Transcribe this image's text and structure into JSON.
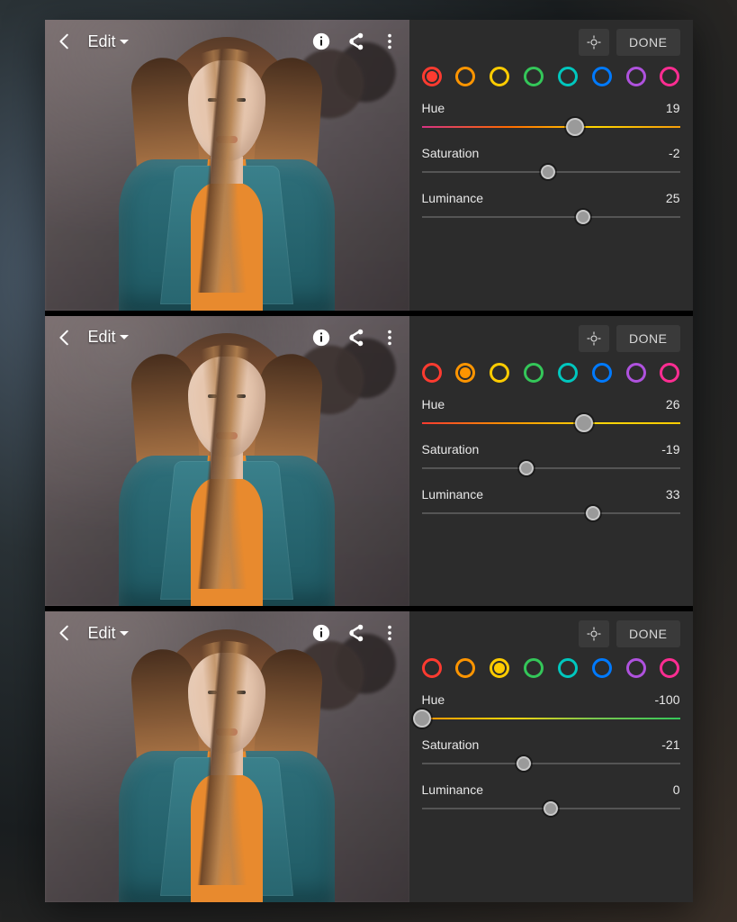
{
  "header": {
    "title": "Edit",
    "done_label": "DONE"
  },
  "swatches": [
    {
      "name": "red",
      "color": "#ff3b30"
    },
    {
      "name": "orange",
      "color": "#ff9500"
    },
    {
      "name": "yellow",
      "color": "#ffcc00"
    },
    {
      "name": "green",
      "color": "#34c759"
    },
    {
      "name": "aqua",
      "color": "#00c7be"
    },
    {
      "name": "blue",
      "color": "#007aff"
    },
    {
      "name": "purple",
      "color": "#af52de"
    },
    {
      "name": "magenta",
      "color": "#ff2d92"
    }
  ],
  "slider_labels": {
    "hue": "Hue",
    "saturation": "Saturation",
    "luminance": "Luminance"
  },
  "panels": [
    {
      "selected_swatch": "red",
      "hue": 19,
      "saturation": -2,
      "luminance": 25,
      "hue_bar": "hue-bar",
      "sat_big": false
    },
    {
      "selected_swatch": "orange",
      "hue": 26,
      "saturation": -19,
      "luminance": 33,
      "hue_bar": "hue-bar-o",
      "sat_big": false
    },
    {
      "selected_swatch": "yellow",
      "hue": -100,
      "saturation": -21,
      "luminance": 0,
      "hue_bar": "hue-bar-y",
      "sat_big": false
    }
  ]
}
